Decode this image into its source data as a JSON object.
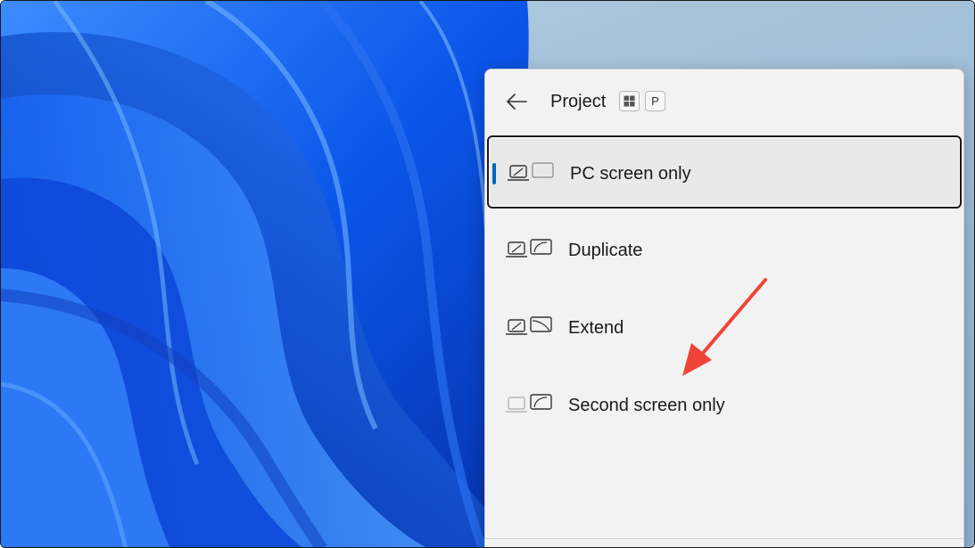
{
  "panel": {
    "title": "Project",
    "shortcut_keys": [
      "win-key-icon",
      "P"
    ],
    "back": "arrow-left-icon"
  },
  "options": [
    {
      "label": "PC screen only",
      "icon": "pc-screen-only-icon",
      "selected": true
    },
    {
      "label": "Duplicate",
      "icon": "duplicate-icon",
      "selected": false
    },
    {
      "label": "Extend",
      "icon": "extend-icon",
      "selected": false
    },
    {
      "label": "Second screen only",
      "icon": "second-screen-only-icon",
      "selected": false
    }
  ],
  "colors": {
    "accent": "#0067c0",
    "annotation_arrow": "#f04438",
    "panel_bg": "#f2f2f2",
    "wallpaper_blue": "#0a4fe0"
  }
}
